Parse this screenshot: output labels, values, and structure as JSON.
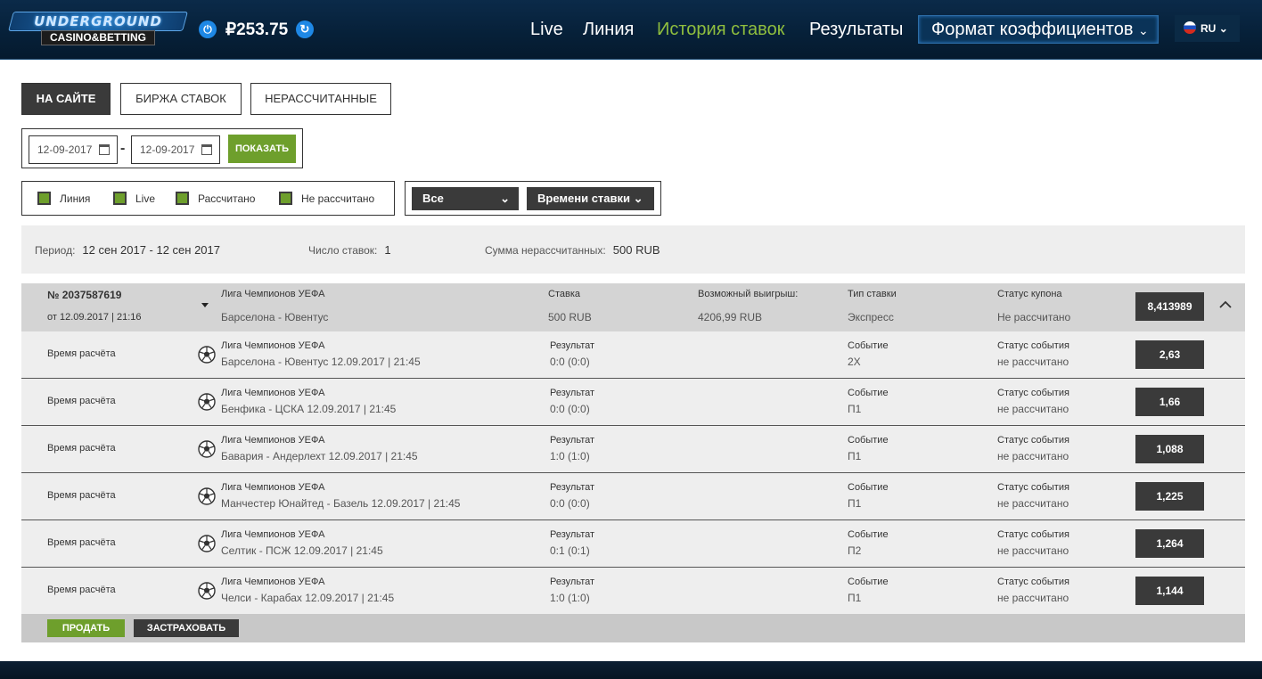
{
  "header": {
    "logo_text": "UNDERGROUND",
    "logo_sub": "CASINO&BETTING",
    "power_icon": "power-icon",
    "balance": "₽253.75",
    "refresh_icon": "refresh-icon",
    "nav": {
      "live": "Live",
      "line": "Линия",
      "history": "История ставок",
      "results": "Результаты"
    },
    "format_label": "Формат коэффициентов",
    "lang": "RU"
  },
  "tabs": [
    "НА САЙТЕ",
    "БИРЖА СТАВОК",
    "НЕРАССЧИТАННЫЕ"
  ],
  "date_filter": {
    "from": "12-09-2017",
    "separator": "-",
    "to": "12-09-2017",
    "show_label": "ПОКАЗАТЬ"
  },
  "checkboxes": [
    "Линия",
    "Live",
    "Рассчитано",
    "Не рассчитано"
  ],
  "selects": {
    "type": "Все",
    "sort": "Времени ставки"
  },
  "summary": {
    "period_label": "Период:",
    "period_value": "12 сен 2017 - 12 сен 2017",
    "count_label": "Число ставок:",
    "count_value": "1",
    "unsettled_label": "Сумма нерассчитанных:",
    "unsettled_value": "500 RUB"
  },
  "coupon": {
    "number": "№ 2037587619",
    "date": "от 12.09.2017 | 21:16",
    "league": "Лига Чемпионов УЕФА",
    "match": "Барселона - Ювентус",
    "stake_label": "Ставка",
    "stake_value": "500 RUB",
    "win_label": "Возможный выигрыш:",
    "win_value": "4206,99 RUB",
    "type_label": "Тип ставки",
    "type_value": "Экспресс",
    "status_label": "Статус купона",
    "status_value": "Не рассчитано",
    "total_odds": "8,413989"
  },
  "events": [
    {
      "calc": "Время расчёта",
      "league": "Лига Чемпионов УЕФА",
      "match": "Барселона - Ювентус 12.09.2017 | 21:45",
      "result_label": "Результат",
      "result": "0:0 (0:0)",
      "event_label": "Событие",
      "event": "2X",
      "status_label": "Статус события",
      "status": "не рассчитано",
      "odd": "2,63"
    },
    {
      "calc": "Время расчёта",
      "league": "Лига Чемпионов УЕФА",
      "match": "Бенфика - ЦСКА 12.09.2017 | 21:45",
      "result_label": "Результат",
      "result": "0:0 (0:0)",
      "event_label": "Событие",
      "event": "П1",
      "status_label": "Статус события",
      "status": "не рассчитано",
      "odd": "1,66"
    },
    {
      "calc": "Время расчёта",
      "league": "Лига Чемпионов УЕФА",
      "match": "Бавария - Андерлехт 12.09.2017 | 21:45",
      "result_label": "Результат",
      "result": "1:0 (1:0)",
      "event_label": "Событие",
      "event": "П1",
      "status_label": "Статус события",
      "status": "не рассчитано",
      "odd": "1,088"
    },
    {
      "calc": "Время расчёта",
      "league": "Лига Чемпионов УЕФА",
      "match": "Манчестер Юнайтед - Базель 12.09.2017 | 21:45",
      "result_label": "Результат",
      "result": "0:0 (0:0)",
      "event_label": "Событие",
      "event": "П1",
      "status_label": "Статус события",
      "status": "не рассчитано",
      "odd": "1,225"
    },
    {
      "calc": "Время расчёта",
      "league": "Лига Чемпионов УЕФА",
      "match": "Селтик - ПСЖ 12.09.2017 | 21:45",
      "result_label": "Результат",
      "result": "0:1 (0:1)",
      "event_label": "Событие",
      "event": "П2",
      "status_label": "Статус события",
      "status": "не рассчитано",
      "odd": "1,264"
    },
    {
      "calc": "Время расчёта",
      "league": "Лига Чемпионов УЕФА",
      "match": "Челси - Карабах 12.09.2017 | 21:45",
      "result_label": "Результат",
      "result": "1:0 (1:0)",
      "event_label": "Событие",
      "event": "П1",
      "status_label": "Статус события",
      "status": "не рассчитано",
      "odd": "1,144"
    }
  ],
  "actions": {
    "sell": "ПРОДАТЬ",
    "insure": "ЗАСТРАХОВАТЬ"
  },
  "colors": {
    "accent_green": "#6e9f2c",
    "dark_button": "#3a3a3a",
    "header_bg": "#062038",
    "active_nav": "#8fbe3e"
  }
}
